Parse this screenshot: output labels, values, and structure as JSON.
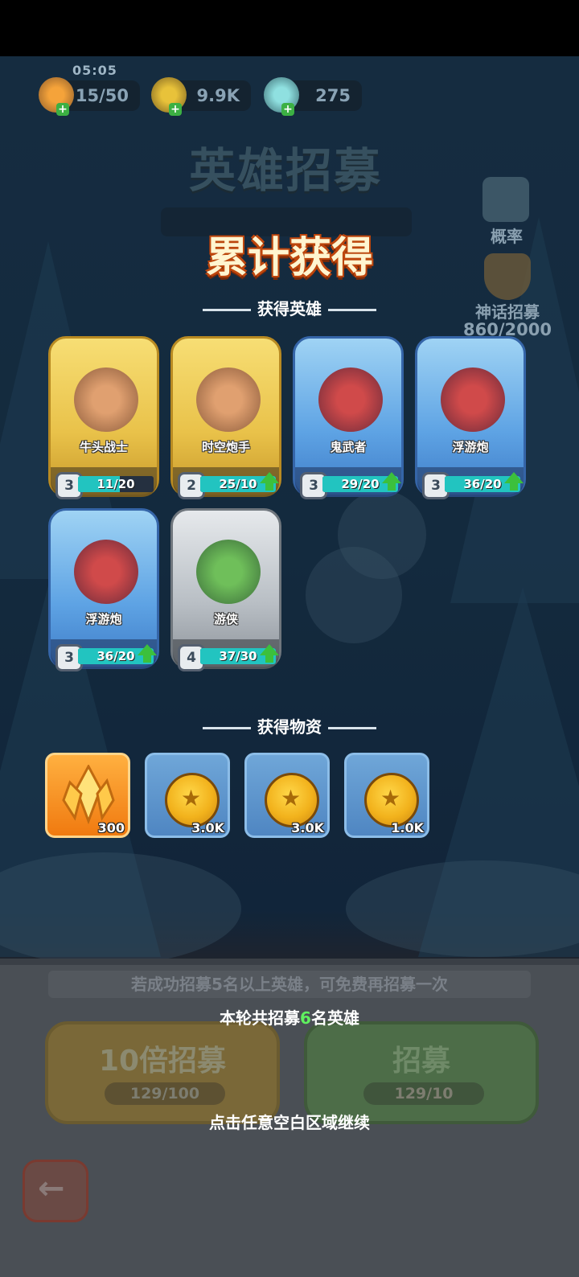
{
  "hud": {
    "clock": "05:05",
    "energy": "15/50",
    "gold": "9.9K",
    "gems": "275"
  },
  "title": {
    "background_title": "英雄招募",
    "headline": "累计获得"
  },
  "side": {
    "probability_label": "概率",
    "mythic_label": "神话招募",
    "mythic_progress": "860/2000"
  },
  "heroes_section": {
    "label": "获得英雄",
    "heroes": [
      {
        "name": "牛头战士",
        "level": "3",
        "progress": "11/20",
        "fill": 0.55,
        "upgradable": false,
        "rarity": "gold"
      },
      {
        "name": "时空炮手",
        "level": "2",
        "progress": "25/10",
        "fill": 1.0,
        "upgradable": true,
        "rarity": "gold"
      },
      {
        "name": "鬼武者",
        "level": "3",
        "progress": "29/20",
        "fill": 1.0,
        "upgradable": true,
        "rarity": "blue"
      },
      {
        "name": "浮游炮",
        "level": "3",
        "progress": "36/20",
        "fill": 1.0,
        "upgradable": true,
        "rarity": "blue"
      },
      {
        "name": "浮游炮",
        "level": "3",
        "progress": "36/20",
        "fill": 1.0,
        "upgradable": true,
        "rarity": "blue"
      },
      {
        "name": "游侠",
        "level": "4",
        "progress": "37/30",
        "fill": 1.0,
        "upgradable": true,
        "rarity": "gray"
      }
    ]
  },
  "items_section": {
    "label": "获得物资",
    "items": [
      {
        "type": "crystal",
        "qty": "300"
      },
      {
        "type": "coin",
        "qty": "3.0K"
      },
      {
        "type": "coin",
        "qty": "3.0K"
      },
      {
        "type": "coin",
        "qty": "1.0K"
      }
    ]
  },
  "bottom": {
    "free_hint": "若成功招募5名以上英雄，可免费再招募一次",
    "recruit_summary_prefix": "本轮共招募",
    "recruit_summary_count": "6",
    "recruit_summary_suffix": "名英雄",
    "ten_recruit_label": "10倍招募",
    "ten_recruit_cost": "129/100",
    "recruit_label": "招募",
    "recruit_cost": "129/10",
    "continue_hint": "点击任意空白区域继续"
  },
  "colors": {
    "progress_fill": "#22c4c0",
    "upgrade_arrow": "#3cc03c",
    "highlight_count": "#5ff05f"
  }
}
